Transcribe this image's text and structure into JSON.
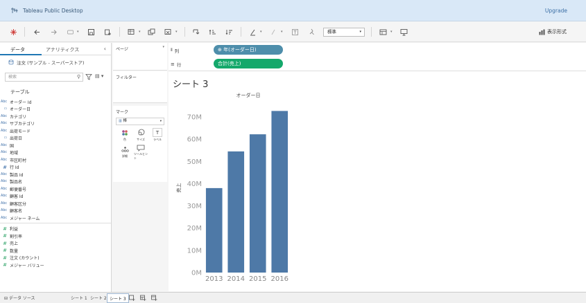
{
  "app": {
    "title": "Tableau Public Desktop",
    "upgrade": "Upgrade"
  },
  "toolbar": {
    "fit": "標準",
    "show_me": "表示形式"
  },
  "data_pane": {
    "tabs": [
      "データ",
      "アナリティクス"
    ],
    "datasource": "注文 (サンプル - スーパーストア)",
    "search_placeholder": "検索",
    "section": "テーブル",
    "dimensions": [
      {
        "type": "Abc",
        "name": "オーダー Id"
      },
      {
        "type": "date",
        "name": "オーダー日"
      },
      {
        "type": "Abc",
        "name": "カテゴリ"
      },
      {
        "type": "Abc",
        "name": "サブカテゴリ"
      },
      {
        "type": "Abc",
        "name": "出荷モード"
      },
      {
        "type": "date",
        "name": "出荷日"
      },
      {
        "type": "Abc",
        "name": "国"
      },
      {
        "type": "Abc",
        "name": "地域"
      },
      {
        "type": "Abc",
        "name": "市区町村"
      },
      {
        "type": "#",
        "name": "行 Id"
      },
      {
        "type": "Abc",
        "name": "製品 Id"
      },
      {
        "type": "Abc",
        "name": "製品名"
      },
      {
        "type": "Abc",
        "name": "郵便番号"
      },
      {
        "type": "Abc",
        "name": "顧客 Id"
      },
      {
        "type": "Abc",
        "name": "顧客区分"
      },
      {
        "type": "Abc",
        "name": "顧客名"
      },
      {
        "type": "Abc",
        "name": "メジャー ネーム"
      }
    ],
    "measures": [
      {
        "type": "#",
        "name": "利益"
      },
      {
        "type": "#",
        "name": "割引率"
      },
      {
        "type": "#",
        "name": "売上"
      },
      {
        "type": "#",
        "name": "数量"
      },
      {
        "type": "#",
        "name": "注文 (カウント)"
      },
      {
        "type": "#",
        "name": "メジャー バリュー"
      }
    ]
  },
  "cards": {
    "pages": "ページ",
    "filters": "フィルター",
    "marks": "マーク",
    "mark_type": "棒",
    "mark_buttons": [
      "色",
      "サイズ",
      "ラベル",
      "詳細",
      "ツールヒント"
    ]
  },
  "shelves": {
    "columns_label": "列",
    "rows_label": "行",
    "columns_pill": "年(オーダー日)",
    "rows_pill": "合計(売上)"
  },
  "sheet": {
    "title": "シート 3"
  },
  "bottom_tabs": {
    "datasource": "データ ソース",
    "sheets": [
      "シート 1",
      "シート 2",
      "シート 3"
    ]
  },
  "colors": {
    "bar": "#4e79a7",
    "dim_pill": "#4e8eab",
    "measure_pill": "#14a86b",
    "title_bar": "#d9e8f7"
  },
  "chart_data": {
    "type": "bar",
    "title": "オーダー日",
    "ylabel": "売上",
    "categories": [
      "2013",
      "2014",
      "2015",
      "2016"
    ],
    "values": [
      38000000,
      54500000,
      62200000,
      72700000
    ],
    "ylim": [
      0,
      75000000
    ],
    "yticks": [
      0,
      10000000,
      20000000,
      30000000,
      40000000,
      50000000,
      60000000,
      70000000
    ],
    "ytick_labels": [
      "0M",
      "10M",
      "20M",
      "30M",
      "40M",
      "50M",
      "60M",
      "70M"
    ],
    "grid": false
  }
}
